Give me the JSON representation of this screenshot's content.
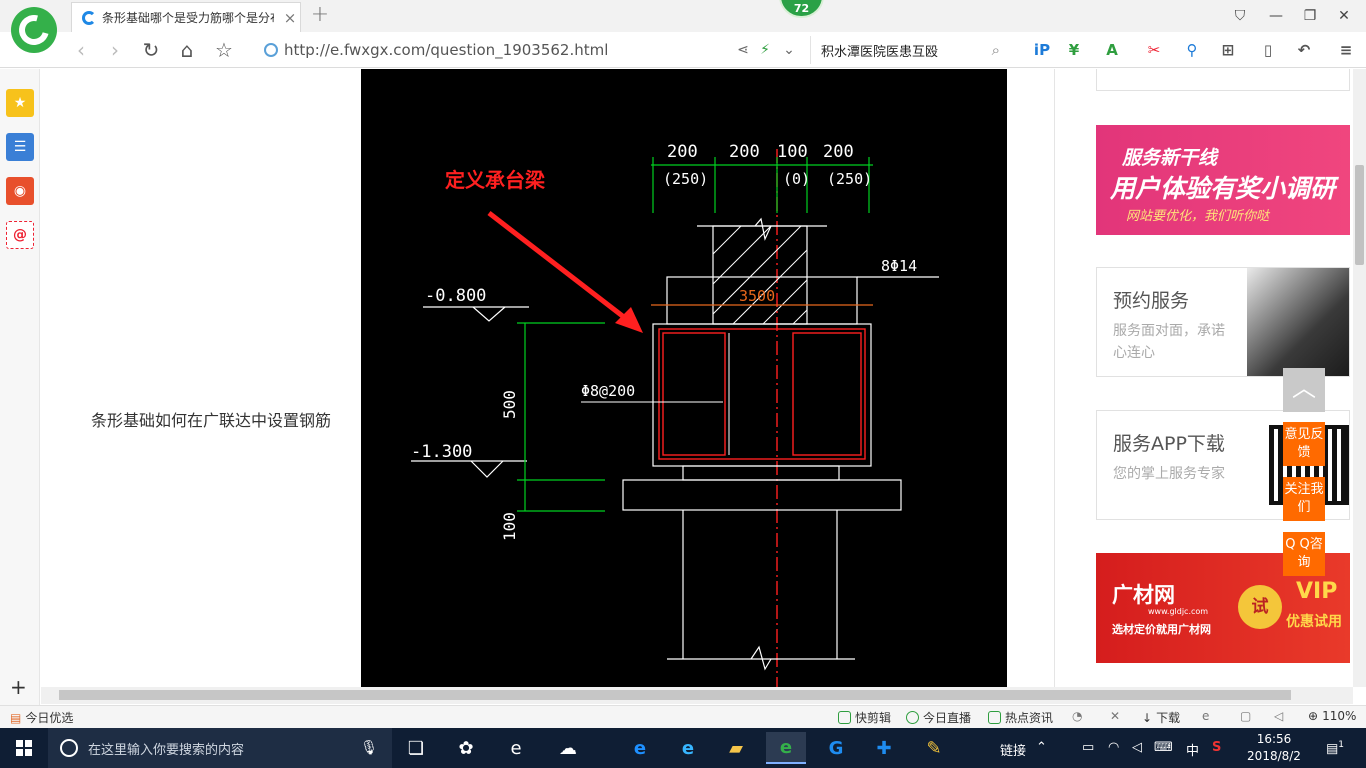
{
  "browser": {
    "tab_title": "条形基础哪个是受力筋哪个是分布",
    "tab_close": "×",
    "new_tab": "+",
    "badge": "72",
    "url": "http://e.fwxgx.com/question_1903562.html",
    "search_text": "积水潭医院医患互殴",
    "zoom": "110%"
  },
  "page": {
    "question_text": "条形基础如何在广联达中设置钢筋",
    "drawing": {
      "annotation": "定义承台梁",
      "dims_top": [
        "200",
        "200",
        "100",
        "200"
      ],
      "dims_top_paren": [
        "(250)",
        "(0)",
        "(250)"
      ],
      "rebar_top": "8Φ14",
      "width_label": "3500",
      "stirrup_label": "Φ8@200",
      "elev_top": "-0.800",
      "elev_bottom": "-1.300",
      "height_label": "500",
      "pad_label": "100"
    },
    "right_panel": {
      "survey": {
        "line1": "服务新干线",
        "line2": "用户体验有奖小调研",
        "line3": "网站要优化，我们听你哒"
      },
      "appointment": {
        "title": "预约服务",
        "subtitle": "服务面对面，承诺心连心"
      },
      "app_download": {
        "title": "服务APP下载",
        "subtitle": "您的掌上服务专家"
      },
      "guangcai": {
        "logo": "广材网",
        "url": "www.gldjc.com",
        "slogan": "选材定价就用广材网",
        "try": "试",
        "vip": "VIP",
        "vip2": "优惠试用"
      }
    },
    "float_buttons": {
      "top": "︿",
      "feedback": "意见反馈",
      "follow": "关注我们",
      "qq": "Q Q咨询"
    }
  },
  "statusbar": {
    "left": "今日优选",
    "kuaijianji": "快剪辑",
    "live": "今日直播",
    "news": "热点资讯",
    "download": "下载",
    "zoom": "110%"
  },
  "taskbar": {
    "search_placeholder": "在这里输入你要搜索的内容",
    "links": "链接",
    "ime": "中",
    "time": "16:56",
    "date": "2018/8/2",
    "notif_count": "1"
  },
  "colors": {
    "browser_green": "#34b04a",
    "float_orange": "#ff6a00",
    "cad_red": "#ff2020",
    "cad_green": "#00d020",
    "taskbar": "#0f1e34"
  }
}
